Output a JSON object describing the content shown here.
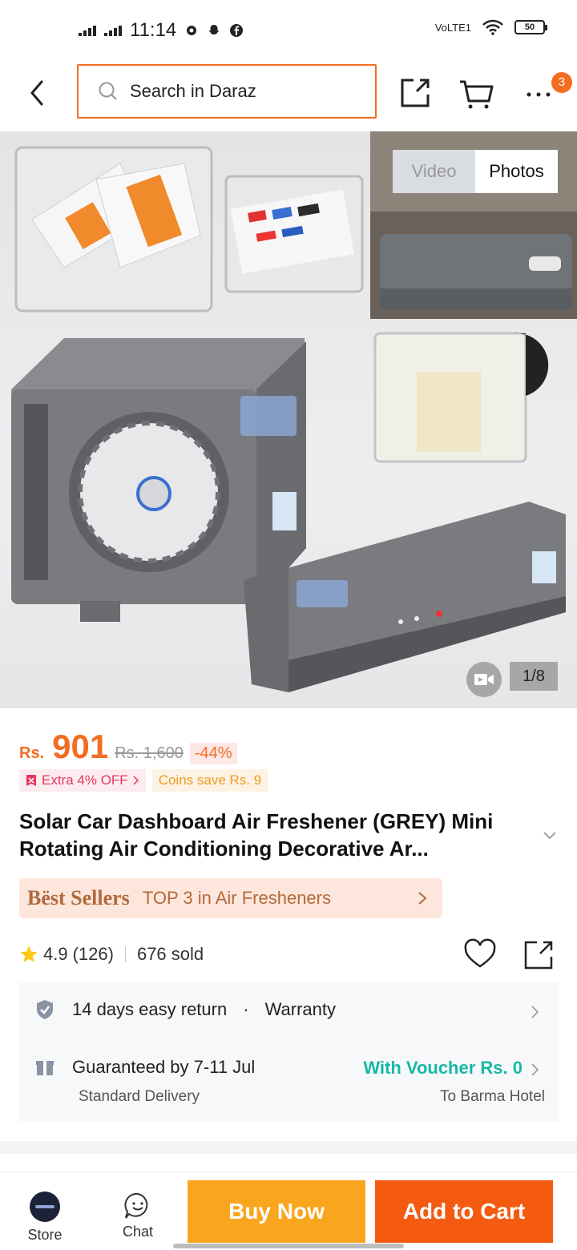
{
  "status": {
    "time": "11:14",
    "network": "VoLTE1",
    "battery": "50"
  },
  "header": {
    "search_placeholder": "Search in Daraz",
    "cart_badge": "3"
  },
  "gallery": {
    "toggle": [
      "Video",
      "Photos"
    ],
    "counter": "1/8"
  },
  "price": {
    "currency": "Rs.",
    "current": "901",
    "original": "Rs. 1,600",
    "discount": "-44%"
  },
  "promos": {
    "extra": "Extra 4% OFF",
    "coins": "Coins save Rs. 9"
  },
  "product": {
    "title": "Solar Car Dashboard Air Freshener (GREY) Mini Rotating Air Conditioning Decorative Ar..."
  },
  "best_sellers": {
    "brand": "Bëst Sellers",
    "text": "TOP 3 in Air Fresheners"
  },
  "rating": {
    "score": "4.9",
    "count": "(126)",
    "sold": "676 sold"
  },
  "service": {
    "return": "14 days easy return",
    "warranty": "Warranty",
    "guarantee": "Guaranteed by 7-11 Jul",
    "voucher": "With Voucher Rs. 0",
    "delivery": "Standard Delivery",
    "destination": "To Barma Hotel"
  },
  "bottom": {
    "store": "Store",
    "chat": "Chat",
    "buy_now": "Buy Now",
    "add_to_cart": "Add to Cart"
  },
  "colors": {
    "accent": "#f36d21",
    "buy_now": "#f9a51e",
    "add_to_cart": "#f45b11",
    "voucher": "#17b8a6"
  }
}
